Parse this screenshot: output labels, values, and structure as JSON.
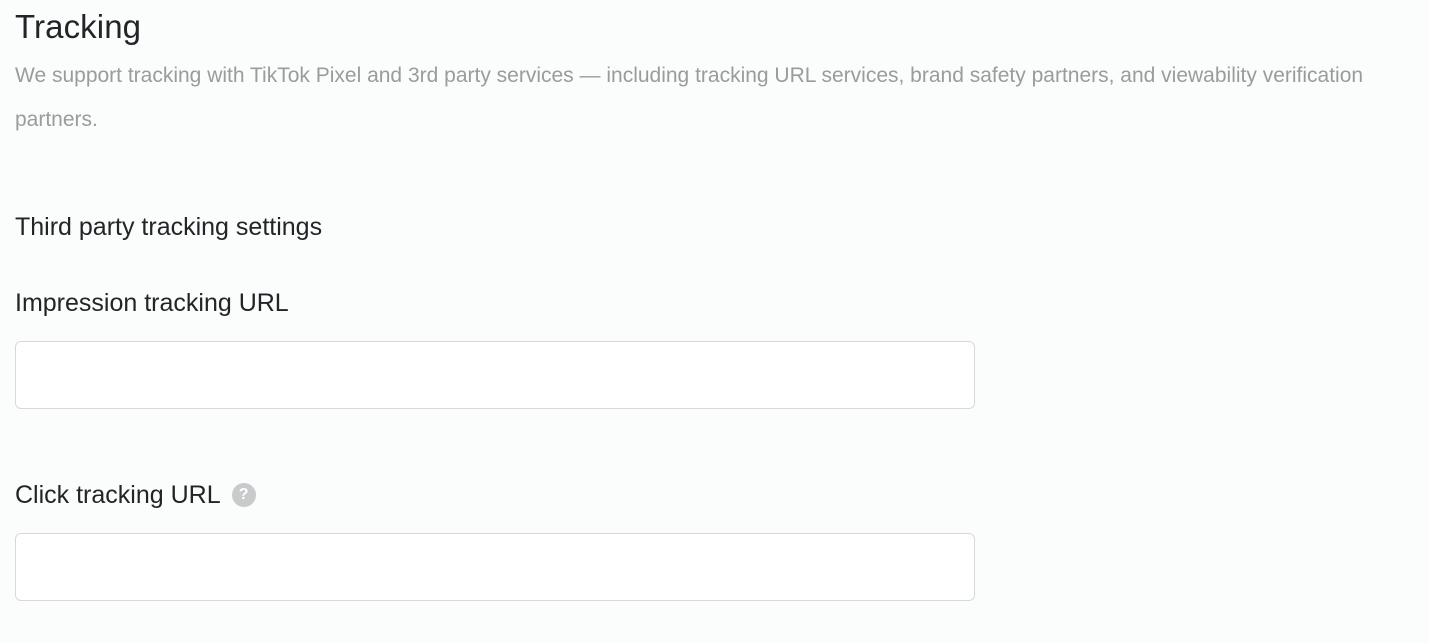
{
  "section": {
    "title": "Tracking",
    "description": "We support tracking with TikTok Pixel and 3rd party services — including tracking URL services, brand safety partners, and viewability verification partners."
  },
  "third_party": {
    "title": "Third party tracking settings",
    "fields": [
      {
        "label": "Impression tracking URL",
        "value": "",
        "placeholder": ""
      },
      {
        "label": "Click tracking URL",
        "help_icon": "question-mark",
        "help_glyph": "?",
        "value": "",
        "placeholder": ""
      }
    ]
  }
}
